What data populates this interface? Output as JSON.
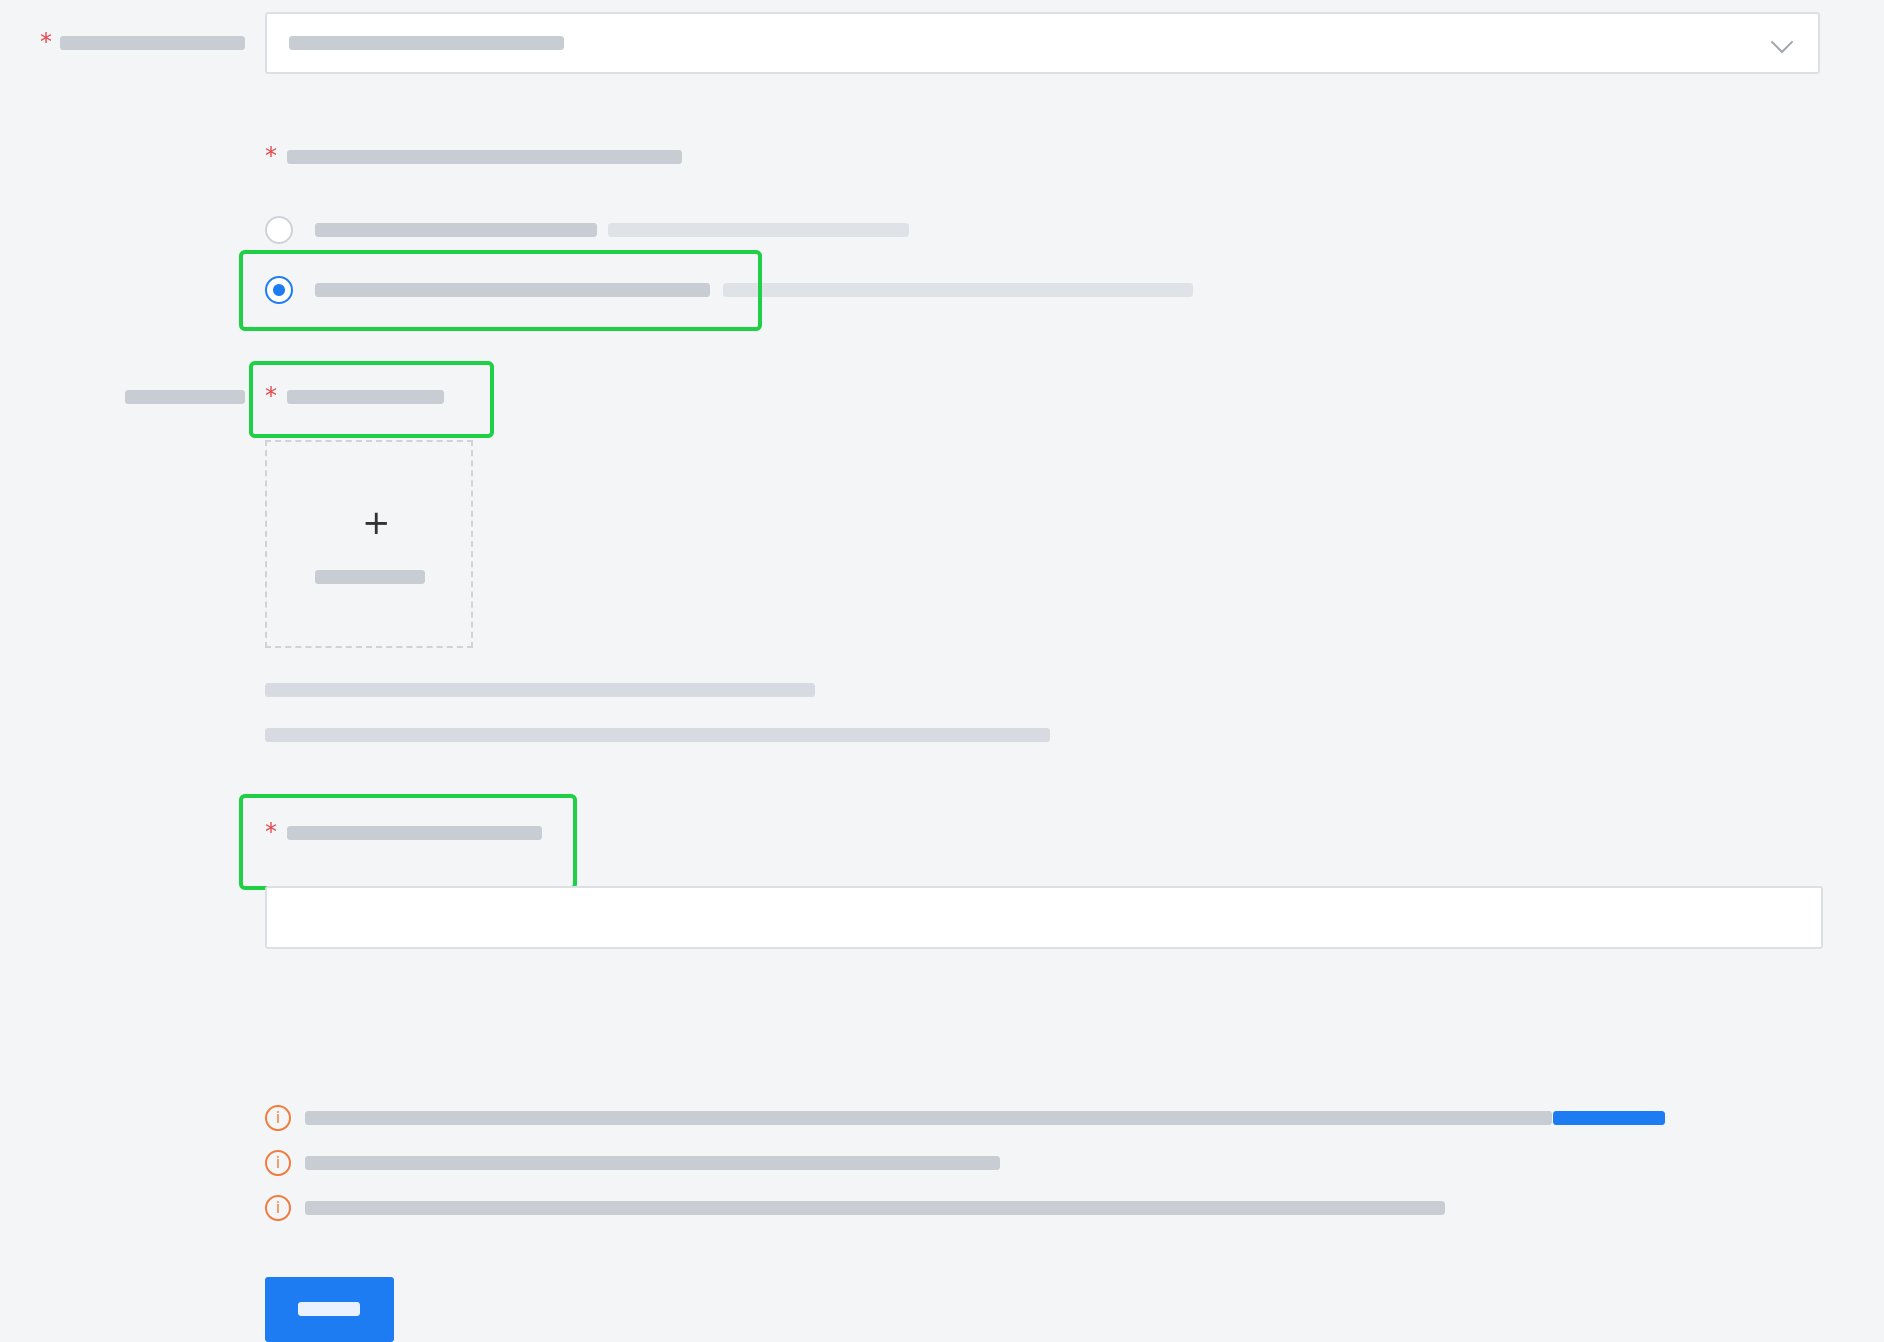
{
  "colors": {
    "accent": "#1d7cf2",
    "required": "#e5484d",
    "highlight": "#1fcf45",
    "warning": "#f07c3f",
    "background": "#f4f5f7"
  },
  "icons": {
    "select": "chevron-down-icon",
    "upload": "plus-icon",
    "notice": "info-icon"
  },
  "state": {
    "selected_option_index": 1
  }
}
